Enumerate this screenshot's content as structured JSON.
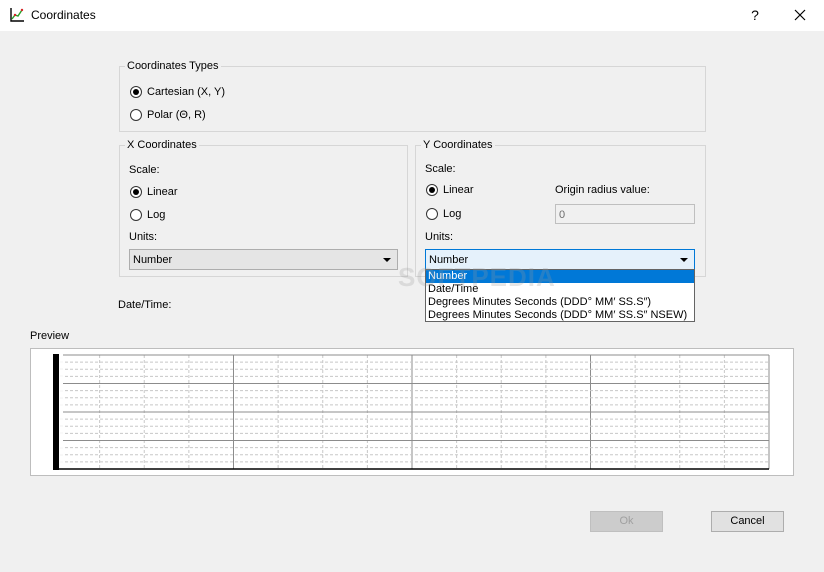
{
  "window": {
    "title": "Coordinates",
    "help": "?",
    "close": "✕"
  },
  "coord_types": {
    "title": "Coordinates Types",
    "options": [
      {
        "label": "Cartesian (X, Y)",
        "checked": true
      },
      {
        "label": "Polar (Θ, R)",
        "checked": false
      }
    ]
  },
  "x_coords": {
    "title": "X Coordinates",
    "scale_label": "Scale:",
    "scale_options": [
      {
        "label": "Linear",
        "checked": true
      },
      {
        "label": "Log",
        "checked": false
      }
    ],
    "units_label": "Units:",
    "units_value": "Number"
  },
  "y_coords": {
    "title": "Y Coordinates",
    "scale_label": "Scale:",
    "scale_options": [
      {
        "label": "Linear",
        "checked": true
      },
      {
        "label": "Log",
        "checked": false
      }
    ],
    "origin_label": "Origin radius value:",
    "origin_value": "0",
    "units_label": "Units:",
    "units_value": "Number",
    "units_options": [
      "Number",
      "Date/Time",
      "Degrees Minutes Seconds (DDD° MM′ SS.S″)",
      "Degrees Minutes Seconds (DDD° MM′ SS.S″ NSEW)"
    ],
    "selected_option": 0
  },
  "datetime_label": "Date/Time:",
  "preview_label": "Preview",
  "watermark": "SOFTPEDIA",
  "buttons": {
    "ok": "Ok",
    "cancel": "Cancel"
  },
  "colors": {
    "accent": "#0078d7",
    "grid_major": "#8c8c8c",
    "grid_minor": "#c8c8c8",
    "axis": "#000000"
  }
}
